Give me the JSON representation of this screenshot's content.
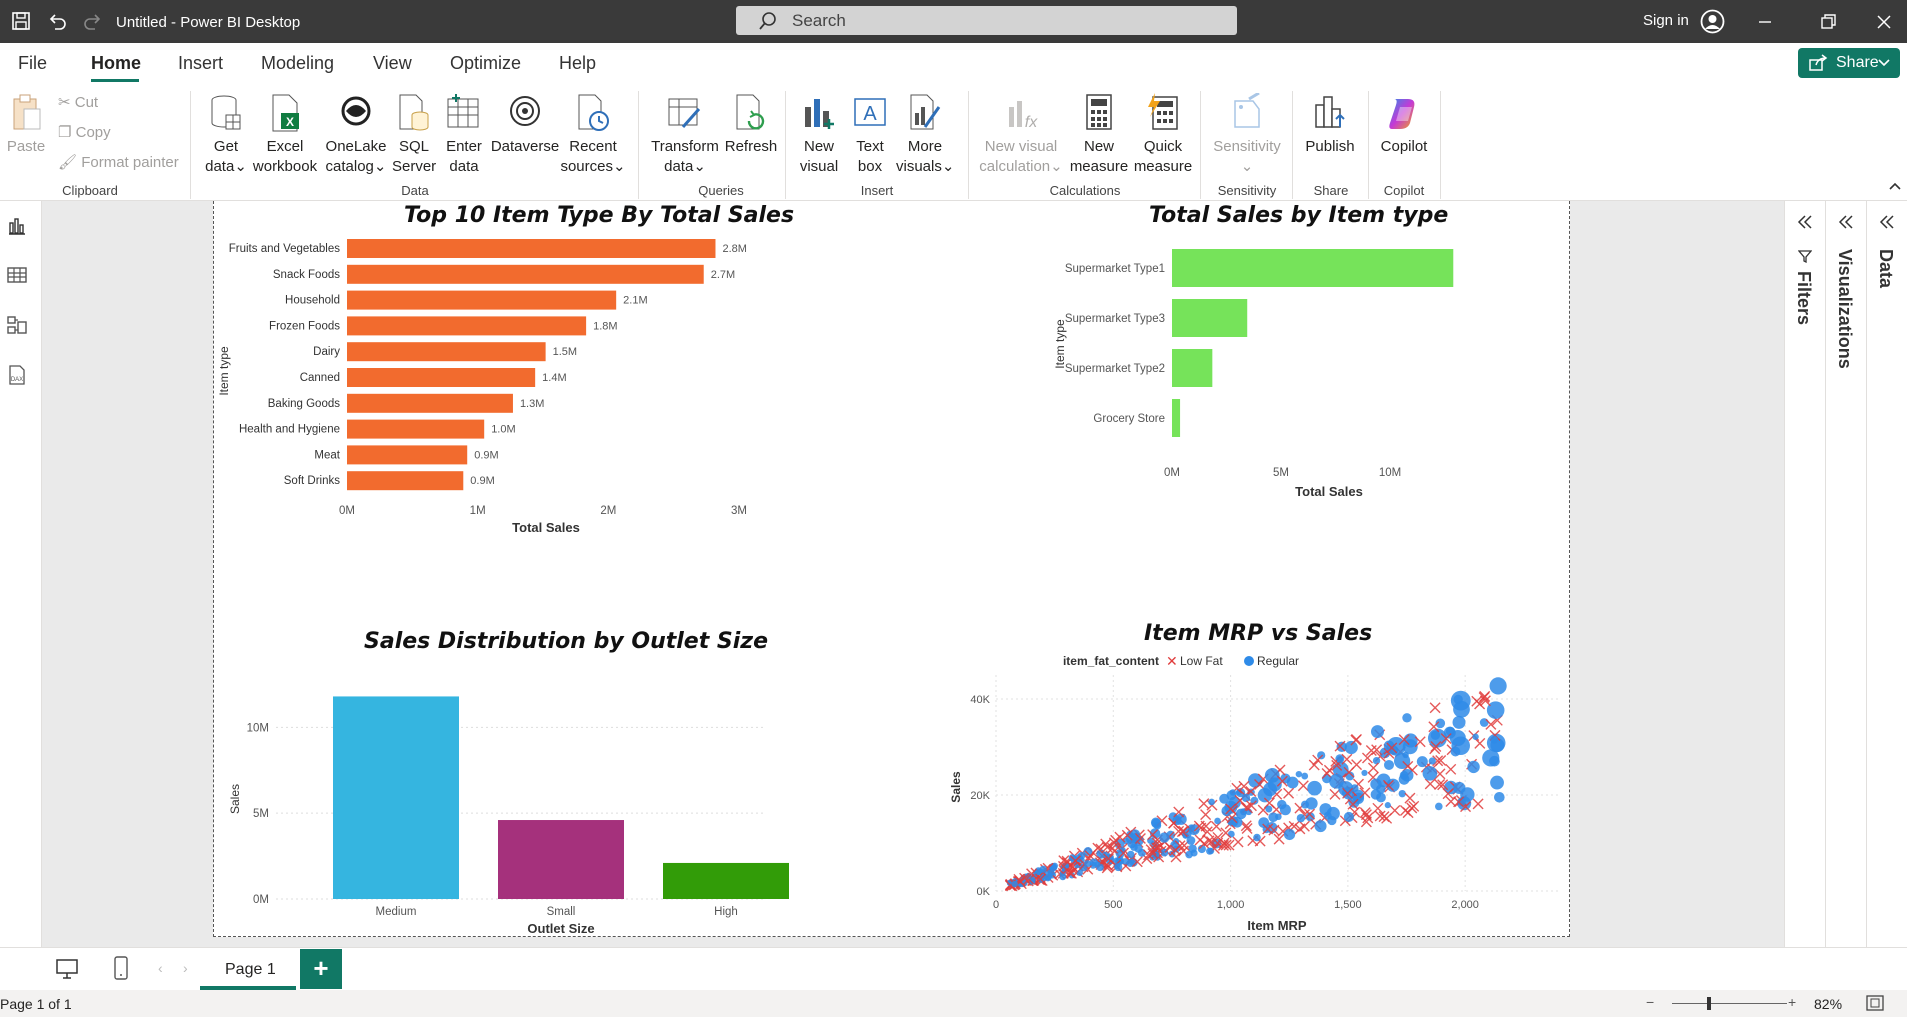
{
  "window": {
    "title": "Untitled - Power BI Desktop",
    "search_placeholder": "Search",
    "sign_in": "Sign in"
  },
  "menu": {
    "tabs": [
      "File",
      "Home",
      "Insert",
      "Modeling",
      "View",
      "Optimize",
      "Help"
    ],
    "active": "Home",
    "share_label": "Share"
  },
  "ribbon": {
    "clipboard": {
      "paste": "Paste",
      "cut": "Cut",
      "copy": "Copy",
      "format_painter": "Format painter",
      "group": "Clipboard"
    },
    "data": {
      "get_data": [
        "Get",
        "data"
      ],
      "excel": [
        "Excel",
        "workbook"
      ],
      "onelake": [
        "OneLake",
        "catalog"
      ],
      "sql": [
        "SQL",
        "Server"
      ],
      "enter": [
        "Enter",
        "data"
      ],
      "dataverse": "Dataverse",
      "recent": [
        "Recent",
        "sources"
      ],
      "group": "Data"
    },
    "queries": {
      "transform": [
        "Transform",
        "data"
      ],
      "refresh": "Refresh",
      "group": "Queries"
    },
    "insert": {
      "new_visual": [
        "New",
        "visual"
      ],
      "text_box": [
        "Text",
        "box"
      ],
      "more_visuals": [
        "More",
        "visuals"
      ],
      "group": "Insert"
    },
    "calculations": {
      "new_visual_calc": [
        "New visual",
        "calculation"
      ],
      "new_measure": [
        "New",
        "measure"
      ],
      "quick_measure": [
        "Quick",
        "measure"
      ],
      "group": "Calculations"
    },
    "sensitivity": {
      "label": "Sensitivity",
      "group": "Sensitivity"
    },
    "share": {
      "publish": "Publish",
      "group": "Share"
    },
    "copilot": {
      "label": "Copilot",
      "group": "Copilot"
    }
  },
  "panes": {
    "filters": "Filters",
    "visualizations": "Visualizations",
    "data": "Data"
  },
  "pages": {
    "tab": "Page 1",
    "add": "+",
    "status": "Page 1 of 1",
    "zoom": "82%"
  },
  "colors": {
    "accent": "#117865",
    "orange": "#f26b2e",
    "green": "#76e35a",
    "medium": "#35b5e0",
    "small": "#a5317c",
    "high": "#329c08",
    "low_fat": "#e03c3c",
    "regular": "#2f8be8"
  },
  "chart_data": [
    {
      "type": "bar",
      "title": "Top 10 Item Type By Total Sales",
      "orientation": "horizontal",
      "categories": [
        "Fruits and Vegetables",
        "Snack Foods",
        "Household",
        "Frozen Foods",
        "Dairy",
        "Canned",
        "Baking Goods",
        "Health and Hygiene",
        "Meat",
        "Soft Drinks"
      ],
      "values": [
        2.82,
        2.73,
        2.06,
        1.83,
        1.52,
        1.44,
        1.27,
        1.05,
        0.92,
        0.89
      ],
      "labels": [
        "2.8M",
        "2.7M",
        "2.1M",
        "1.8M",
        "1.5M",
        "1.4M",
        "1.3M",
        "1.0M",
        "0.9M",
        "0.9M"
      ],
      "xlabel": "Total Sales",
      "ylabel": "Item type",
      "ticks": [
        "0M",
        "1M",
        "2M",
        "3M"
      ],
      "xlim": [
        0,
        3
      ]
    },
    {
      "type": "bar",
      "title": "Total Sales by Item type",
      "orientation": "horizontal",
      "categories": [
        "Supermarket Type1",
        "Supermarket Type3",
        "Supermarket Type2",
        "Grocery Store"
      ],
      "values": [
        12.9,
        3.45,
        1.85,
        0.37
      ],
      "xlabel": "Total Sales",
      "ylabel": "Item type",
      "ticks": [
        "0M",
        "5M",
        "10M"
      ],
      "xlim": [
        0,
        13.3
      ]
    },
    {
      "type": "bar",
      "title": "Sales Distribution by Outlet Size",
      "categories": [
        "Medium",
        "Small",
        "High"
      ],
      "values": [
        11.8,
        4.6,
        2.1
      ],
      "xlabel": "Outlet Size",
      "ylabel": "Sales",
      "ticks": [
        "0M",
        "5M",
        "10M"
      ],
      "ylim": [
        0,
        12
      ]
    },
    {
      "type": "scatter",
      "title": "Item MRP vs Sales",
      "xlabel": "Item MRP",
      "ylabel": "Sales",
      "legend_title": "item_fat_content",
      "series": [
        {
          "name": "Low Fat",
          "marker": "x"
        },
        {
          "name": "Regular",
          "marker": "circle"
        }
      ],
      "x_ticks": [
        "0",
        "500",
        "1,000",
        "1,500",
        "2,000"
      ],
      "y_ticks": [
        "0K",
        "20K",
        "40K"
      ],
      "xlim": [
        0,
        2400
      ],
      "ylim": [
        0,
        45000
      ],
      "legend_position": "top-left",
      "pattern": "positive correlation, sales rising with MRP"
    }
  ]
}
